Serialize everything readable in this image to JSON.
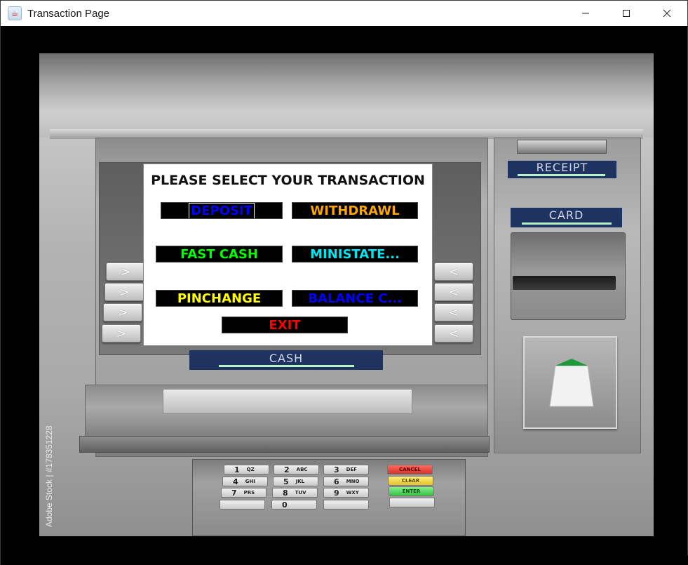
{
  "window": {
    "title": "Transaction Page",
    "icon": "java-cup-icon",
    "controls": [
      "minimize-icon",
      "maximize-icon",
      "close-icon"
    ]
  },
  "screen": {
    "heading": "PLEASE SELECT YOUR TRANSACTION",
    "options": {
      "deposit": {
        "label": "DEPOSIT",
        "color": "#0000ff"
      },
      "withdrawl": {
        "label": "WITHDRAWL",
        "color": "#ffa500"
      },
      "fast_cash": {
        "label": "FAST CASH",
        "color": "#00ff00"
      },
      "ministatement": {
        "label": "MINISTATE...",
        "color": "#00e5ee"
      },
      "pinchange": {
        "label": "PINCHANGE",
        "color": "#ffff00"
      },
      "balance": {
        "label": "BALANCE C...",
        "color": "#0000ff"
      },
      "exit": {
        "label": "EXIT",
        "color": "#ff0000"
      }
    }
  },
  "atm": {
    "side_button_left_glyph": ">",
    "side_button_right_glyph": "<",
    "receipt_label": "RECEIPT",
    "card_label": "CARD",
    "cash_label": "CASH",
    "keypad": {
      "keys": [
        {
          "main": "1",
          "sub": "QZ"
        },
        {
          "main": "2",
          "sub": "ABC"
        },
        {
          "main": "3",
          "sub": "DEF"
        },
        {
          "main": "4",
          "sub": "GHI"
        },
        {
          "main": "5",
          "sub": "JKL"
        },
        {
          "main": "6",
          "sub": "MNO"
        },
        {
          "main": "7",
          "sub": "PRS"
        },
        {
          "main": "8",
          "sub": "TUV"
        },
        {
          "main": "9",
          "sub": "WXY"
        },
        {
          "main": "0",
          "sub": ""
        }
      ],
      "function_keys": [
        "CANCEL",
        "CLEAR",
        "ENTER"
      ]
    },
    "watermark": "Adobe Stock | #178351228"
  },
  "colors": {
    "label_bg": "#1e3360",
    "label_text": "#cfd6e8",
    "label_bar": "#b7f3c6",
    "cancel": "#e03a2f",
    "clear": "#e8c832",
    "enter": "#4bd35a"
  }
}
